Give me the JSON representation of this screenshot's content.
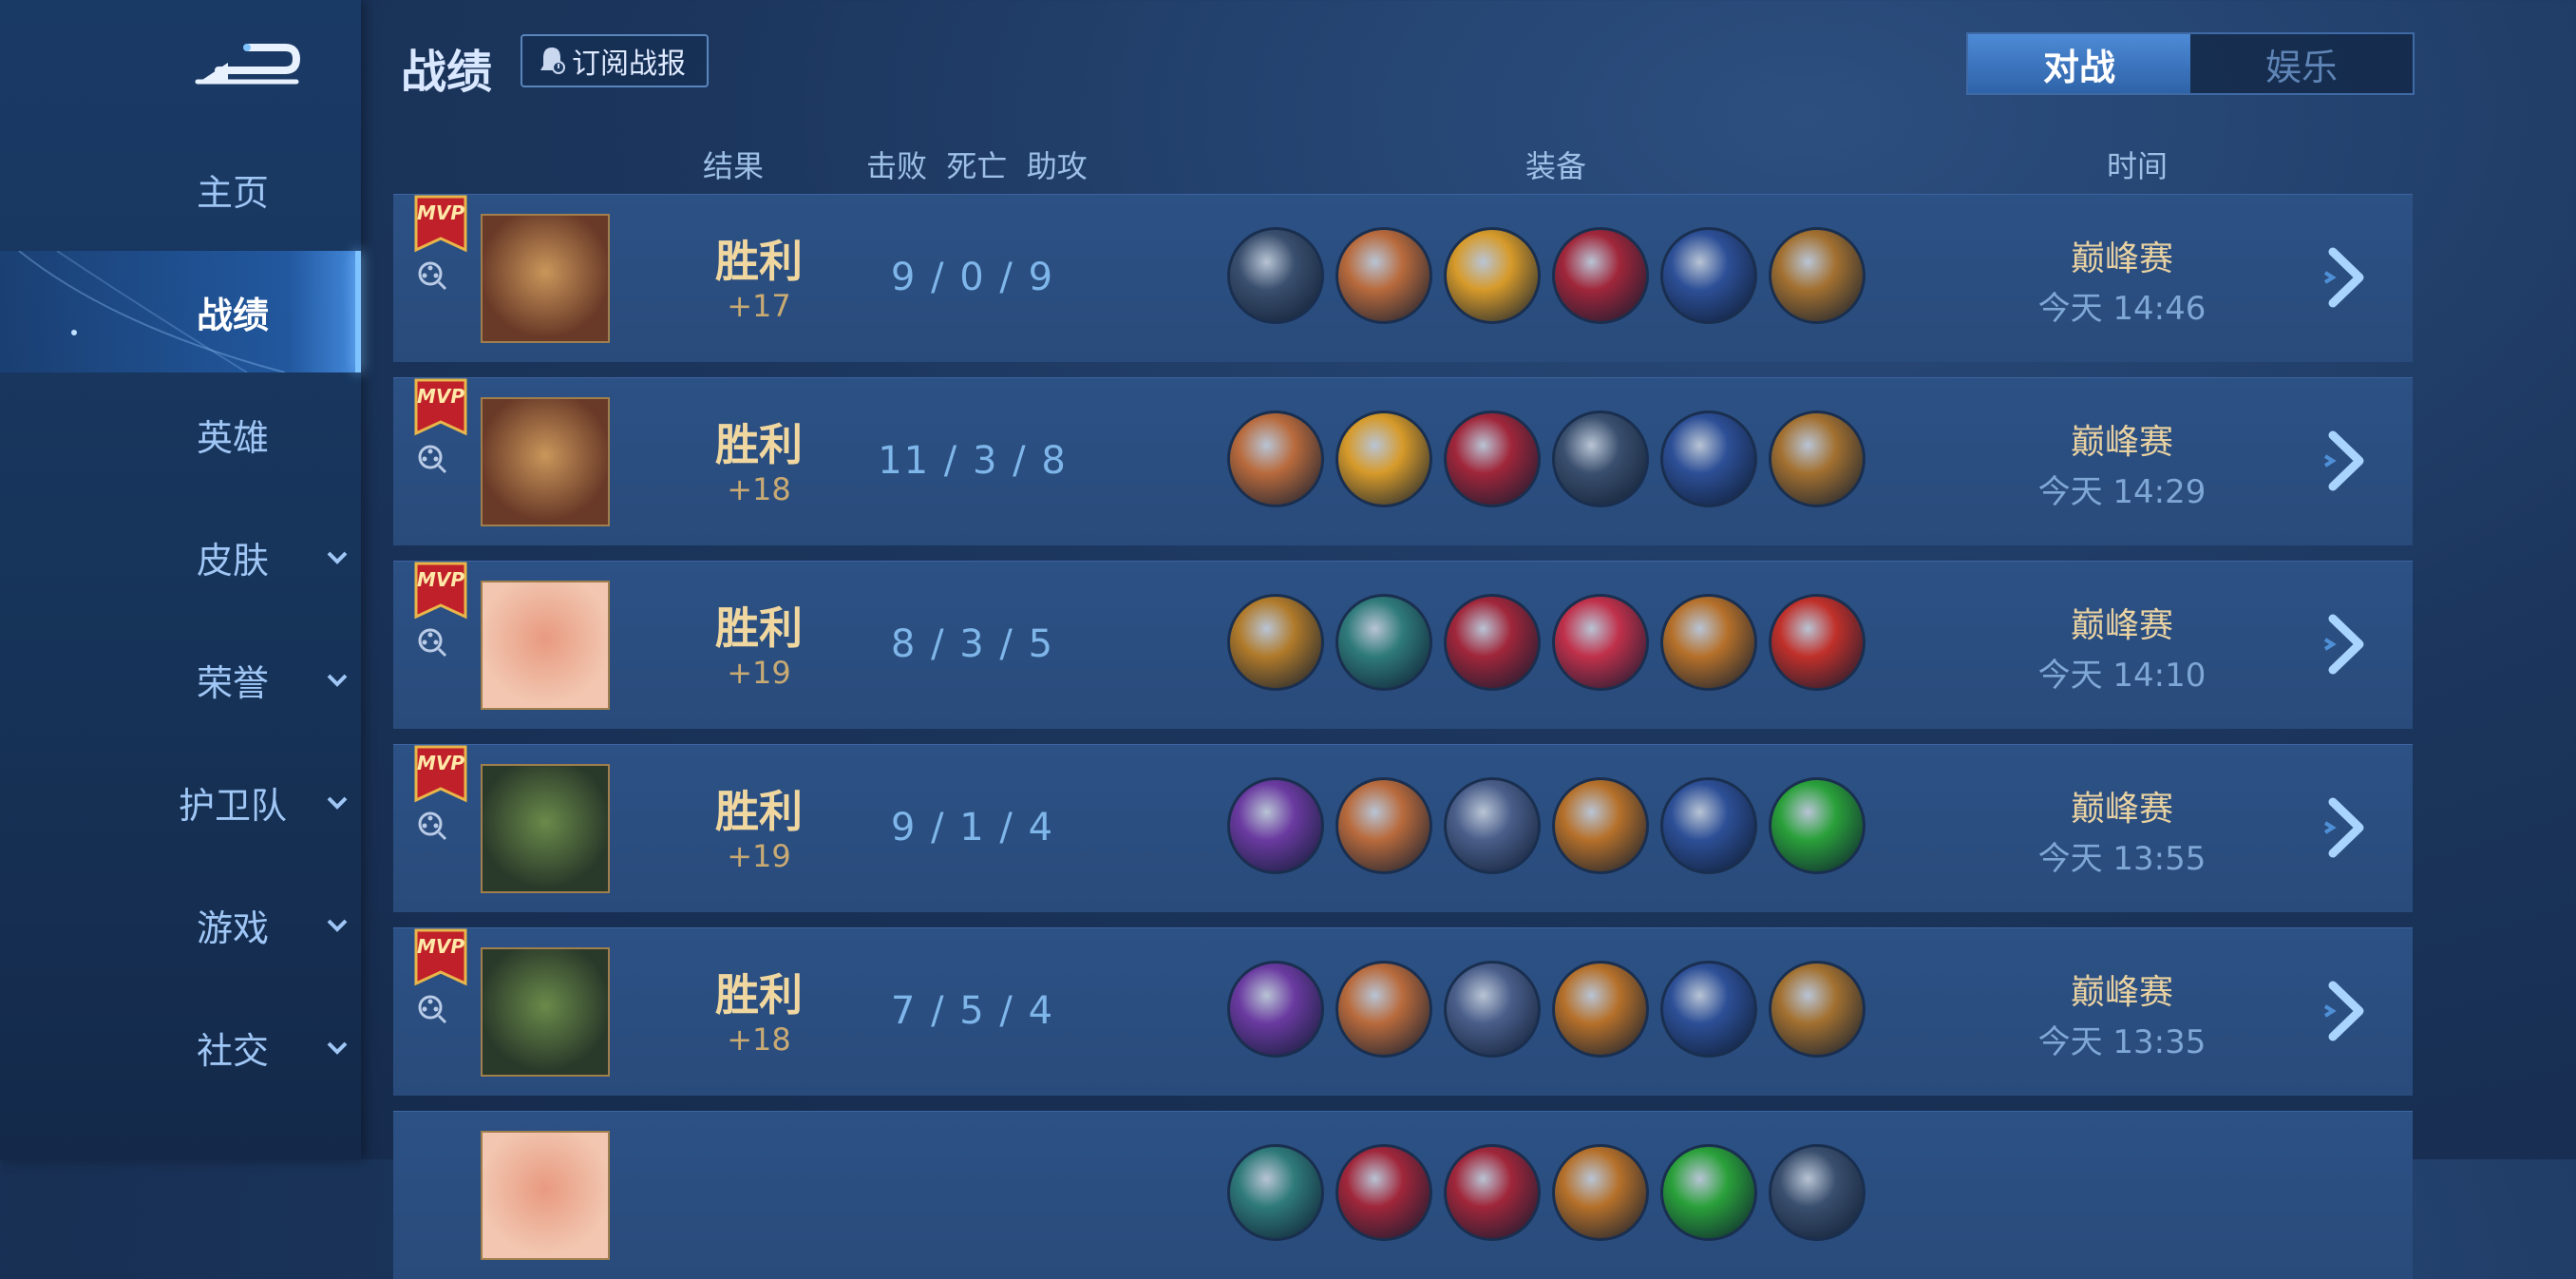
{
  "sidebar": {
    "items": [
      {
        "label": "主页",
        "has_chevron": false,
        "active": false
      },
      {
        "label": "战绩",
        "has_chevron": false,
        "active": true
      },
      {
        "label": "英雄",
        "has_chevron": false,
        "active": false
      },
      {
        "label": "皮肤",
        "has_chevron": true,
        "active": false
      },
      {
        "label": "荣誉",
        "has_chevron": true,
        "active": false
      },
      {
        "label": "护卫队",
        "has_chevron": true,
        "active": false
      },
      {
        "label": "游戏",
        "has_chevron": true,
        "active": false
      },
      {
        "label": "社交",
        "has_chevron": true,
        "active": false
      }
    ]
  },
  "header": {
    "title": "战绩",
    "subscribe_label": "订阅战报",
    "tabs": [
      {
        "label": "对战",
        "active": true
      },
      {
        "label": "娱乐",
        "active": false
      }
    ]
  },
  "columns": {
    "result": "结果",
    "kda": "击败  死亡  助攻",
    "items": "装备",
    "time": "时间"
  },
  "matches": [
    {
      "badge": "MVP",
      "result": "胜利",
      "score": "+17",
      "kda": "9 / 0 / 9",
      "mode": "巅峰赛",
      "time": "今天 14:46",
      "items": [
        "#3a4f6e",
        "#b86a3c",
        "#d69a2a",
        "#a0263a",
        "#2d4f96",
        "#a27030"
      ]
    },
    {
      "badge": "MVP",
      "result": "胜利",
      "score": "+18",
      "kda": "11 / 3 / 8",
      "mode": "巅峰赛",
      "time": "今天 14:29",
      "items": [
        "#b86a3c",
        "#d69a2a",
        "#a0263a",
        "#3a4f6e",
        "#2d4f96",
        "#a27030"
      ]
    },
    {
      "badge": "MVP",
      "result": "胜利",
      "score": "+19",
      "kda": "8 / 3 / 5",
      "mode": "巅峰赛",
      "time": "今天 14:10",
      "items": [
        "#b07a2a",
        "#2f7a7a",
        "#a0263a",
        "#c0304a",
        "#b5702a",
        "#c0302a"
      ]
    },
    {
      "badge": "MVP",
      "result": "胜利",
      "score": "+19",
      "kda": "9 / 1 / 4",
      "mode": "巅峰赛",
      "time": "今天 13:55",
      "items": [
        "#6a3aa0",
        "#b86a3c",
        "#4a5e8a",
        "#b5702a",
        "#2d4f96",
        "#2aa03a"
      ]
    },
    {
      "badge": "MVP",
      "result": "胜利",
      "score": "+18",
      "kda": "7 / 5 / 4",
      "mode": "巅峰赛",
      "time": "今天 13:35",
      "items": [
        "#6a3aa0",
        "#b86a3c",
        "#4a5e8a",
        "#b5702a",
        "#2d4f96",
        "#a27030"
      ]
    },
    {
      "badge": "",
      "result": "",
      "score": "",
      "kda": "",
      "mode": "",
      "time": "",
      "items": [
        "#2f7a7a",
        "#a0263a",
        "#a0263a",
        "#b5702a",
        "#2aa03a",
        "#3a4f6e"
      ]
    }
  ],
  "colors": {
    "accent": "#4d8ad6",
    "win": "#f0d7a0",
    "kda": "#7fb6ea"
  }
}
